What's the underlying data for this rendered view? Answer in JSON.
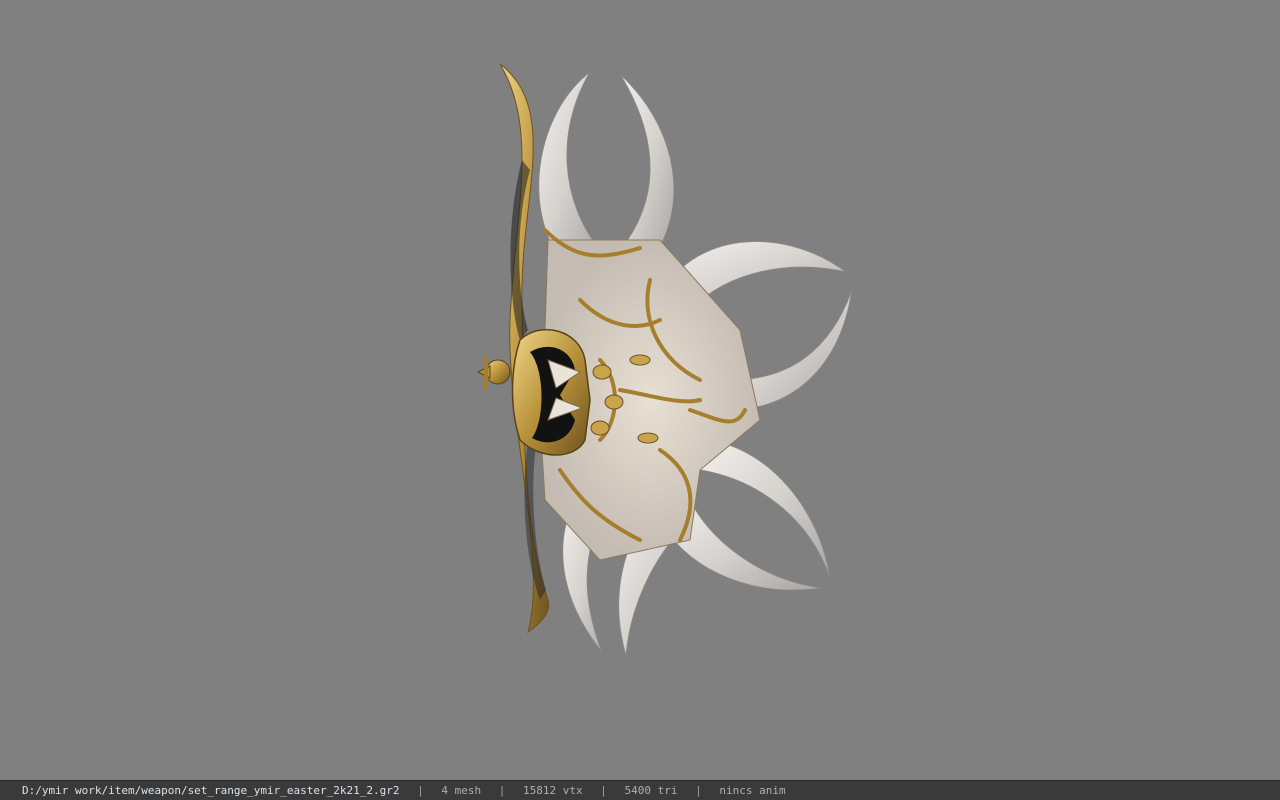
{
  "status_bar": {
    "file_path": "D:/ymir work/item/weapon/set_range_ymir_easter_2k21_2.gr2",
    "separator": "|",
    "mesh": "4 mesh",
    "vertices": "15812 vtx",
    "triangles": "5400 tri",
    "animation": "nincs anim"
  },
  "colors": {
    "background": "#808080",
    "status_bar_bg": "#3a3a3a",
    "blade": "#d8d4d0",
    "gold": "#b8923a"
  }
}
